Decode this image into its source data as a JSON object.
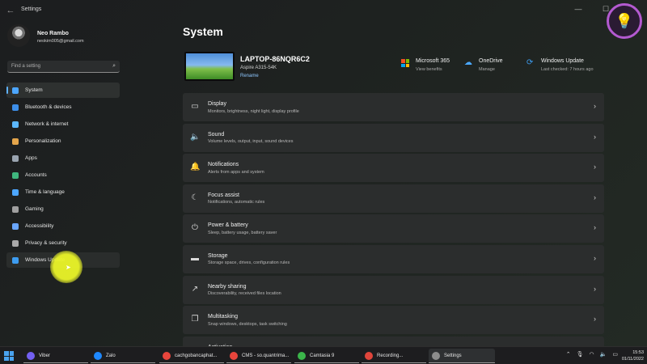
{
  "window": {
    "title": "Settings"
  },
  "profile": {
    "name": "Neo Rambo",
    "email": "neokim005@gmail.com"
  },
  "search": {
    "placeholder": "Find a setting"
  },
  "sidebar": {
    "items": [
      {
        "label": "System",
        "icon": "system-icon",
        "color": "#4ca6ff",
        "active": true
      },
      {
        "label": "Bluetooth & devices",
        "icon": "bluetooth-icon",
        "color": "#3d8ee8"
      },
      {
        "label": "Network & internet",
        "icon": "wifi-icon",
        "color": "#5cb8ff"
      },
      {
        "label": "Personalization",
        "icon": "brush-icon",
        "color": "#e4a54b"
      },
      {
        "label": "Apps",
        "icon": "apps-icon",
        "color": "#9aa4b0"
      },
      {
        "label": "Accounts",
        "icon": "person-icon",
        "color": "#3fb67e"
      },
      {
        "label": "Time & language",
        "icon": "globe-icon",
        "color": "#4ca6ff"
      },
      {
        "label": "Gaming",
        "icon": "gamepad-icon",
        "color": "#a0a0a0"
      },
      {
        "label": "Accessibility",
        "icon": "accessibility-icon",
        "color": "#69a6ff"
      },
      {
        "label": "Privacy & security",
        "icon": "shield-icon",
        "color": "#a9a9a9"
      },
      {
        "label": "Windows Update",
        "icon": "update-icon",
        "color": "#3d9cf0"
      }
    ]
  },
  "main": {
    "title": "System",
    "device": {
      "name": "LAPTOP-86NQR6C2",
      "model": "Aspire A315-54K",
      "rename": "Rename"
    },
    "quick_links": [
      {
        "title": "Microsoft 365",
        "sub": "View benefits",
        "icon": "microsoft-icon"
      },
      {
        "title": "OneDrive",
        "sub": "Manage",
        "icon": "onedrive-icon"
      },
      {
        "title": "Windows Update",
        "sub": "Last checked: 7 hours ago",
        "icon": "update-icon"
      }
    ],
    "cards": [
      {
        "title": "Display",
        "sub": "Monitors, brightness, night light, display profile",
        "icon": "monitor-icon",
        "glyph": "▭"
      },
      {
        "title": "Sound",
        "sub": "Volume levels, output, input, sound devices",
        "icon": "speaker-icon",
        "glyph": "🔈"
      },
      {
        "title": "Notifications",
        "sub": "Alerts from apps and system",
        "icon": "bell-icon",
        "glyph": "🔔"
      },
      {
        "title": "Focus assist",
        "sub": "Notifications, automatic rules",
        "icon": "moon-icon",
        "glyph": "☾"
      },
      {
        "title": "Power & battery",
        "sub": "Sleep, battery usage, battery saver",
        "icon": "power-icon",
        "glyph": "⏻"
      },
      {
        "title": "Storage",
        "sub": "Storage space, drives, configuration rules",
        "icon": "drive-icon",
        "glyph": "▬"
      },
      {
        "title": "Nearby sharing",
        "sub": "Discoverability, received files location",
        "icon": "share-icon",
        "glyph": "↗"
      },
      {
        "title": "Multitasking",
        "sub": "Snap windows, desktops, task switching",
        "icon": "multitask-icon",
        "glyph": "❐"
      },
      {
        "title": "Activation",
        "sub": "",
        "icon": "activation-icon",
        "glyph": "✓"
      }
    ]
  },
  "taskbar": {
    "apps": [
      {
        "label": "Viber",
        "icon": "viber-icon",
        "color": "#7360f2"
      },
      {
        "label": "Zalo",
        "icon": "zalo-icon",
        "color": "#1e88ff"
      },
      {
        "label": "cachgobancaphat...",
        "icon": "chrome-icon",
        "color": "#e8453c"
      },
      {
        "label": "CMS - so.quantrima...",
        "icon": "chrome-icon",
        "color": "#e8453c"
      },
      {
        "label": "Camtasia 9",
        "icon": "camtasia-icon",
        "color": "#3bb54a"
      },
      {
        "label": "Recording...",
        "icon": "recording-icon",
        "color": "#e0453b"
      },
      {
        "label": "Settings",
        "icon": "settings-icon",
        "color": "#8c8c8c",
        "active": true
      }
    ],
    "time": "15:53",
    "date": "01/11/2022"
  }
}
